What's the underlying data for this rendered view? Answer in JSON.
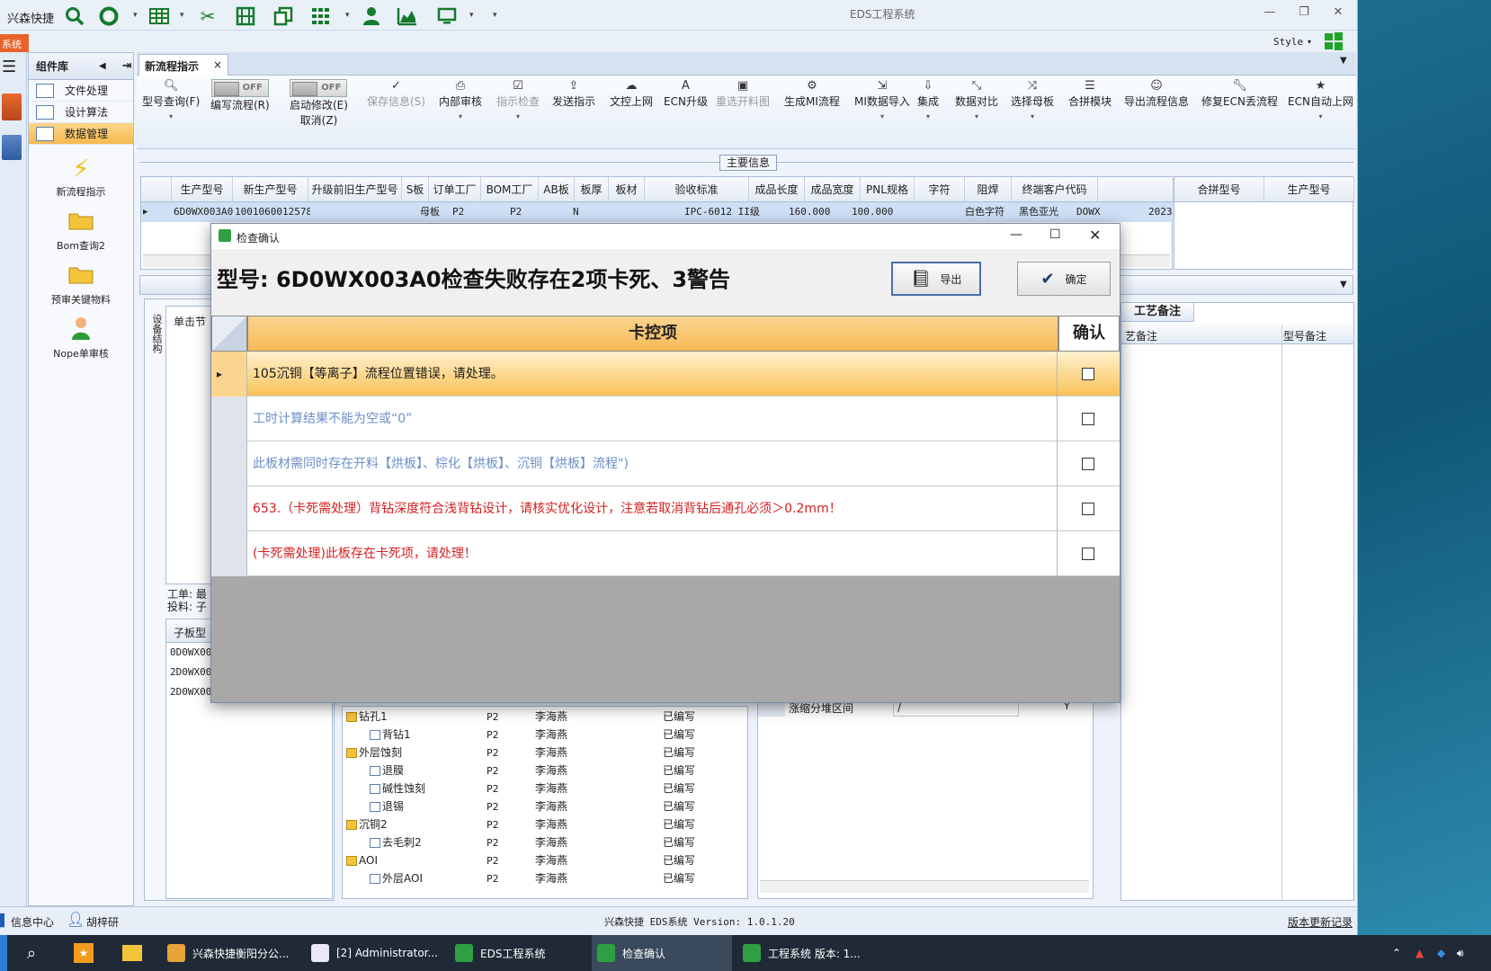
{
  "app": {
    "qa_title": "兴森快捷",
    "window_title": "EDS工程系统",
    "orange_tab": "系统",
    "style_label": "Style"
  },
  "comp_lib": {
    "title": "组件库",
    "items": [
      "文件处理",
      "设计算法",
      "数据管理"
    ],
    "tools": [
      "新流程指示",
      "Bom查询2",
      "预审关键物料",
      "Nope单审核"
    ]
  },
  "doc_tab": "新流程指示",
  "ribbon": {
    "model_query": "型号查询(F)",
    "edit_flow": "编写流程(R)",
    "toggle_off": "OFF",
    "start_modify": "启动修改(E)",
    "cancel": "取消(Z)",
    "save_info": "保存信息(S)",
    "internal_review": "内部审核",
    "indicator_check": "指示检查",
    "send_indicator": "发送指示",
    "upload_doc": "文控上网",
    "ecn_upgrade": "ECN升级",
    "reselect_cut": "重选开料图",
    "gen_mi_flow": "生成MI流程",
    "mi_import": "MI数据导入",
    "integrate": "集成",
    "data_compare": "数据对比",
    "select_mother": "选择母板",
    "merge_module": "合拼模块",
    "export_flow_info": "导出流程信息",
    "repair_ecn": "修复ECN丢流程",
    "ecn_auto_upload": "ECN自动上网"
  },
  "main_info": {
    "label": "主要信息",
    "headers": [
      "生产型号",
      "新生产型号",
      "升级前旧生产型号",
      "S板",
      "订单工厂",
      "BOM工厂",
      "AB板",
      "板厚",
      "板材",
      "验收标准",
      "成品长度",
      "成品宽度",
      "PNL规格",
      "字符",
      "阻焊",
      "终端客户代码"
    ],
    "row": [
      "6D0WX003A0",
      "10010600125788",
      "",
      "母板",
      "P2",
      "P2",
      "N",
      "",
      "",
      "IPC-6012 II级",
      "160.000",
      "100.000",
      "",
      "白色字符",
      "黑色亚光",
      "DOWX",
      "2023-"
    ],
    "side_headers": [
      "合拼型号",
      "生产型号"
    ]
  },
  "left_pane": {
    "vertical_tab": "设备结构",
    "tree_header": "单击节",
    "work_order": "工单: 最",
    "feed": "投料: 子",
    "sub_header": "子板型",
    "sub_rows": [
      "0D0WX00",
      "2D0WX00",
      "2D0WX00"
    ]
  },
  "mid_grid": {
    "rows": [
      {
        "name": "钻孔1",
        "plant": "P2",
        "person": "李海燕",
        "status": "已编写",
        "level": 0,
        "folder": true
      },
      {
        "name": "背钻1",
        "plant": "P2",
        "person": "李海燕",
        "status": "已编写",
        "level": 1,
        "folder": false
      },
      {
        "name": "外层蚀刻",
        "plant": "P2",
        "person": "李海燕",
        "status": "已编写",
        "level": 0,
        "folder": true
      },
      {
        "name": "退膜",
        "plant": "P2",
        "person": "李海燕",
        "status": "已编写",
        "level": 1,
        "folder": false
      },
      {
        "name": "碱性蚀刻",
        "plant": "P2",
        "person": "李海燕",
        "status": "已编写",
        "level": 1,
        "folder": false
      },
      {
        "name": "退锡",
        "plant": "P2",
        "person": "李海燕",
        "status": "已编写",
        "level": 1,
        "folder": false
      },
      {
        "name": "沉铜2",
        "plant": "P2",
        "person": "李海燕",
        "status": "已编写",
        "level": 0,
        "folder": true
      },
      {
        "name": "去毛刺2",
        "plant": "P2",
        "person": "李海燕",
        "status": "已编写",
        "level": 1,
        "folder": false
      },
      {
        "name": "AOI",
        "plant": "P2",
        "person": "李海燕",
        "status": "已编写",
        "level": 0,
        "folder": true
      },
      {
        "name": "外层AOI",
        "plant": "P2",
        "person": "李海燕",
        "status": "已编写",
        "level": 1,
        "folder": false
      }
    ]
  },
  "right_grid": {
    "row_label": "涨缩分堆区间",
    "row_value": "/",
    "row_flag": "Y"
  },
  "craft": {
    "tab": "工艺备注",
    "col1": "艺备注",
    "col2": "型号备注"
  },
  "status_bar": {
    "info_center": "信息中心",
    "user": "胡梓研",
    "version": "兴森快捷 EDS系统 Version: 1.0.1.20",
    "changelog": "版本更新记录"
  },
  "taskbar": {
    "items": [
      "兴森快捷衡阳分公...",
      "[2] Administrator...",
      "EDS工程系统",
      "检查确认",
      "工程系统  版本: 1..."
    ]
  },
  "dialog": {
    "title": "检查确认",
    "heading": "型号: 6D0WX003A0检查失败存在2项卡死、3警告",
    "export_label": "导出",
    "ok_label": "确定",
    "col_item": "卡控项",
    "col_confirm": "确认",
    "rows": [
      {
        "text": "105沉铜【等离子】流程位置错误，请处理。",
        "color": "#1a1a1a",
        "selected": true
      },
      {
        "text": "工时计算结果不能为空或“0”",
        "color": "#6b8fc9",
        "selected": false
      },
      {
        "text": "此板材需同时存在开料【烘板】、棕化【烘板】、沉铜【烘板】流程\")",
        "color": "#6b8fc9",
        "selected": false
      },
      {
        "text": "653.（卡死需处理）背钻深度符合浅背钻设计，请核实优化设计，注意若取消背钻后通孔必须＞0.2mm！",
        "color": "#d42020",
        "selected": false
      },
      {
        "text": "(卡死需处理)此板存在卡死项，请处理！",
        "color": "#d42020",
        "selected": false
      }
    ]
  }
}
